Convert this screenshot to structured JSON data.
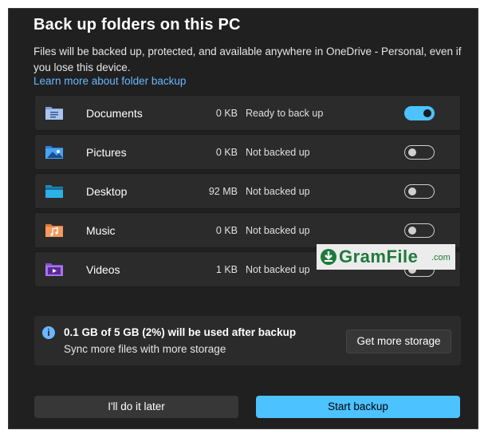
{
  "dialog": {
    "title": "Back up folders on this PC",
    "description": "Files will be backed up, protected, and available anywhere in OneDrive - Personal, even if you lose this device.",
    "learn_more": "Learn more about folder backup"
  },
  "folders": [
    {
      "name": "Documents",
      "size": "0 KB",
      "status": "Ready to back up",
      "enabled": true,
      "icon": "documents-folder-icon"
    },
    {
      "name": "Pictures",
      "size": "0 KB",
      "status": "Not backed up",
      "enabled": false,
      "icon": "pictures-folder-icon"
    },
    {
      "name": "Desktop",
      "size": "92 MB",
      "status": "Not backed up",
      "enabled": false,
      "icon": "desktop-folder-icon"
    },
    {
      "name": "Music",
      "size": "0 KB",
      "status": "Not backed up",
      "enabled": false,
      "icon": "music-folder-icon"
    },
    {
      "name": "Videos",
      "size": "1 KB",
      "status": "Not backed up",
      "enabled": false,
      "icon": "videos-folder-icon"
    }
  ],
  "watermark": {
    "text": "GramFile",
    "suffix": ".com"
  },
  "storage": {
    "main": "0.1 GB of 5 GB (2%) will be used after backup",
    "sub": "Sync more files with more storage",
    "button": "Get more storage",
    "used_fraction": 0.02
  },
  "buttons": {
    "later": "I'll do it later",
    "start": "Start backup"
  },
  "colors": {
    "background": "#202020",
    "row": "#2b2b2b",
    "accent": "#4cc2ff",
    "link": "#69b7ff"
  }
}
